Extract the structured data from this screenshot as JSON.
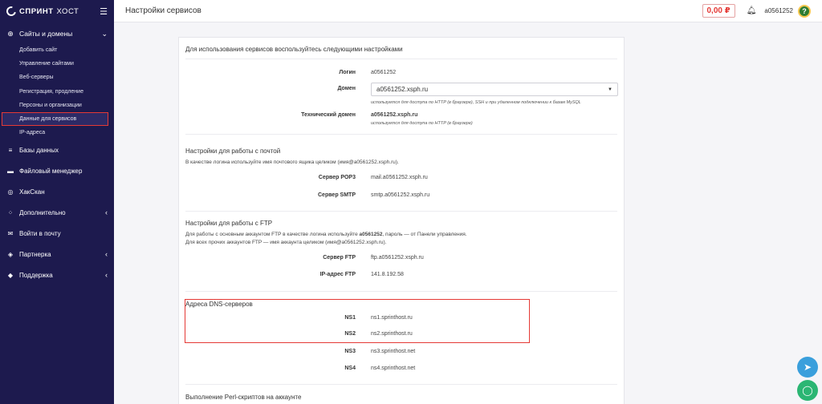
{
  "brand": {
    "bold": "СПРИНТ",
    "thin": "ХОСТ"
  },
  "header": {
    "title": "Настройки сервисов",
    "balance": "0,00 ₽",
    "username": "a0561252",
    "avatar_letter": "?"
  },
  "sidebar": {
    "section": {
      "label": "Сайты и домены",
      "items": [
        "Добавить сайт",
        "Управление сайтами",
        "Веб-серверы",
        "Регистрация, продление",
        "Персоны и организации",
        "Данные для сервисов",
        "IP-адреса"
      ]
    },
    "items": [
      {
        "label": "Базы данных"
      },
      {
        "label": "Файловый менеджер"
      },
      {
        "label": "ХакСкан"
      },
      {
        "label": "Дополнительно"
      },
      {
        "label": "Войти в почту"
      },
      {
        "label": "Партнерка"
      },
      {
        "label": "Поддержка"
      }
    ]
  },
  "content": {
    "intro": "Для использования сервисов воспользуйтесь следующими настройками",
    "login_label": "Логин",
    "login_value": "a0561252",
    "domain_label": "Домен",
    "domain_value": "a0561252.xsph.ru",
    "domain_hint": "используется для доступа по HTTP (в браузере), SSH и при удаленном подключении к базам MySQL",
    "tech_domain_label": "Технический домен",
    "tech_domain_value": "a0561252.xsph.ru",
    "tech_domain_hint": "используется для доступа по HTTP (в браузере)",
    "mail_title": "Настройки для работы с почтой",
    "mail_note": "В качестве логина используйте имя почтового ящика целиком (имя@a0561252.xsph.ru).",
    "pop3_label": "Сервер POP3",
    "pop3_value": "mail.a0561252.xsph.ru",
    "smtp_label": "Сервер SMTP",
    "smtp_value": "smtp.a0561252.xsph.ru",
    "ftp_title": "Настройки для работы с FTP",
    "ftp_note_1a": "Для работы с основным аккаунтом FTP в качестве логина используйте ",
    "ftp_note_1b": "a0561252",
    "ftp_note_1c": ", пароль — от Панели управления.",
    "ftp_note_2": "Для всех прочих аккаунтов FTP — имя аккаунта целиком (имя@a0561252.xsph.ru).",
    "ftp_server_label": "Сервер FTP",
    "ftp_server_value": "ftp.a0561252.xsph.ru",
    "ftp_ip_label": "IP-адрес FTP",
    "ftp_ip_value": "141.8.192.58",
    "dns_title": "Адреса DNS-серверов",
    "ns1_label": "NS1",
    "ns1_value": "ns1.sprinthost.ru",
    "ns2_label": "NS2",
    "ns2_value": "ns2.sprinthost.ru",
    "ns3_label": "NS3",
    "ns3_value": "ns3.sprinthost.net",
    "ns4_label": "NS4",
    "ns4_value": "ns4.sprinthost.net",
    "perl_title": "Выполнение Perl-скриптов на аккаунте"
  },
  "colors": {
    "sidebar": "#1d1a4e",
    "accent_red": "#e53935",
    "telegram": "#3a9fdc",
    "chat": "#2bb673"
  },
  "icons": [
    "globe-icon",
    "database-icon",
    "folder-icon",
    "scan-icon",
    "grid-icon",
    "mail-icon",
    "gift-icon",
    "support-icon",
    "bell-icon",
    "hamburger-icon",
    "telegram-icon",
    "chat-icon"
  ]
}
